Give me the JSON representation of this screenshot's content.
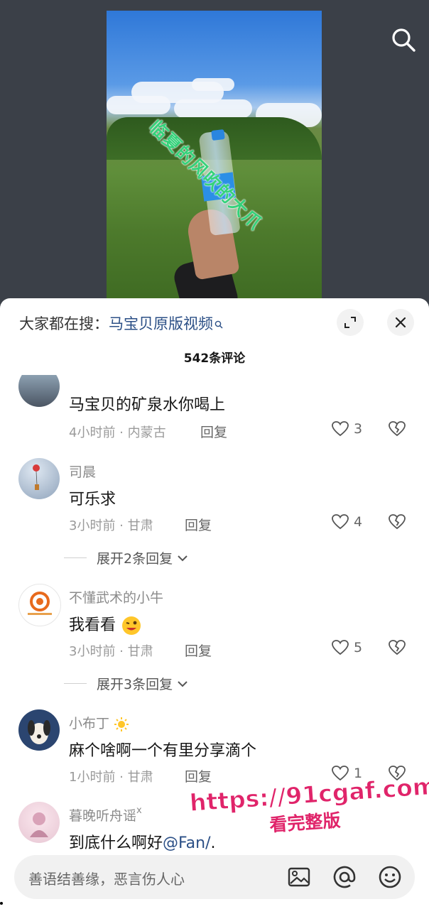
{
  "video": {
    "caption": "临夏的风吹的大爪"
  },
  "top_icons": {
    "search": "search-icon"
  },
  "sheet": {
    "trending_prefix": "大家都在搜：",
    "trending_term": "马宝贝原版视频",
    "comment_count": "542条评论"
  },
  "comments": [
    {
      "name": "",
      "text": "马宝贝的矿泉水你喝上",
      "time_location": "4小时前 · 内蒙古",
      "reply": "回复",
      "likes": "3"
    },
    {
      "name": "司晨",
      "text": "可乐求",
      "time_location": "3小时前 · 甘肃",
      "reply": "回复",
      "likes": "4",
      "expand": "展开2条回复"
    },
    {
      "name": "不懂武术的小牛",
      "text": "我看看",
      "time_location": "3小时前 · 甘肃",
      "reply": "回复",
      "likes": "5",
      "expand": "展开3条回复"
    },
    {
      "name": "小布丁",
      "text": "麻个啥啊一个有里分享滴个",
      "time_location": "1小时前 · 甘肃",
      "reply": "回复",
      "likes": "1"
    },
    {
      "name": "暮晚听舟谣",
      "text": "到底什么啊好",
      "mention": "@Fan/",
      "text_end": "."
    }
  ],
  "watermark": {
    "url": "https://91cgaf.com",
    "subtitle": "看完整版"
  },
  "input": {
    "placeholder": "善语结善缘，恶言伤人心"
  },
  "colors": {
    "link": "#2b4f86",
    "watermark": "#e0246a",
    "caption": "#34d27a"
  }
}
